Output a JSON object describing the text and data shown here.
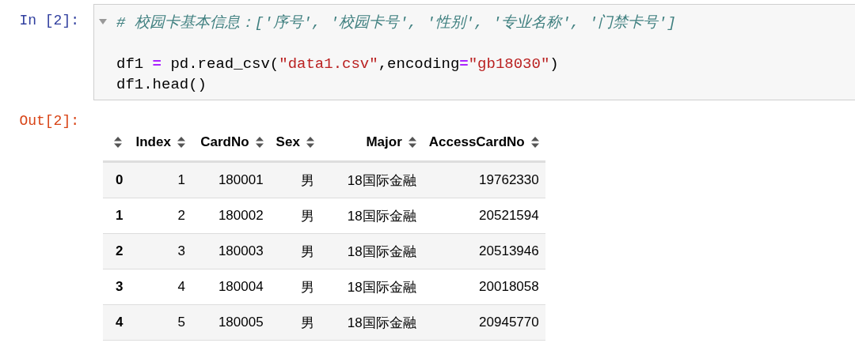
{
  "input_cell": {
    "prompt": "In [2]:",
    "code_blocks": [
      [
        [
          {
            "kind": "comment",
            "text": "# 校园卡基本信息：['序号', '校园卡号', '性别', '专业名称', '门禁卡号']"
          }
        ]
      ],
      [
        [
          {
            "kind": "plain",
            "text": "df1 "
          },
          {
            "kind": "op",
            "text": "="
          },
          {
            "kind": "plain",
            "text": " pd.read_csv("
          },
          {
            "kind": "string",
            "text": "\"data1.csv\""
          },
          {
            "kind": "plain",
            "text": ",encoding"
          },
          {
            "kind": "op",
            "text": "="
          },
          {
            "kind": "string",
            "text": "\"gb18030\""
          },
          {
            "kind": "plain",
            "text": ")"
          }
        ],
        [
          {
            "kind": "plain",
            "text": "df1.head()"
          }
        ]
      ]
    ]
  },
  "output": {
    "prompt": "Out[2]:",
    "table": {
      "columns": [
        "Index",
        "CardNo",
        "Sex",
        "Major",
        "AccessCardNo"
      ],
      "rows": [
        {
          "index": "0",
          "cells": [
            "1",
            "180001",
            "男",
            "18国际金融",
            "19762330"
          ]
        },
        {
          "index": "1",
          "cells": [
            "2",
            "180002",
            "男",
            "18国际金融",
            "20521594"
          ]
        },
        {
          "index": "2",
          "cells": [
            "3",
            "180003",
            "男",
            "18国际金融",
            "20513946"
          ]
        },
        {
          "index": "3",
          "cells": [
            "4",
            "180004",
            "男",
            "18国际金融",
            "20018058"
          ]
        },
        {
          "index": "4",
          "cells": [
            "5",
            "180005",
            "男",
            "18国际金融",
            "20945770"
          ]
        }
      ]
    }
  }
}
